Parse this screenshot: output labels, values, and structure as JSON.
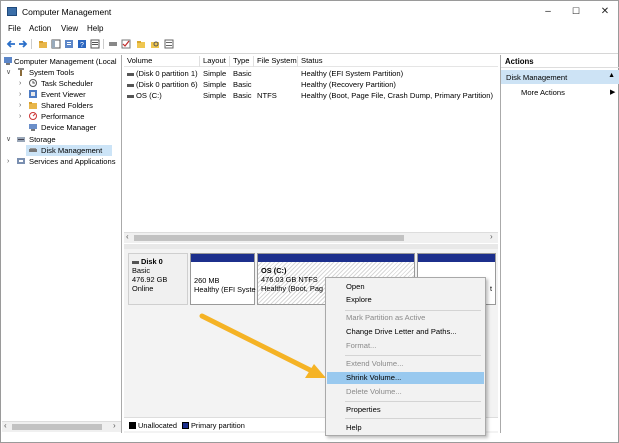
{
  "window": {
    "title": "Computer Management"
  },
  "menu": [
    "File",
    "Action",
    "View",
    "Help"
  ],
  "tree": [
    {
      "label": "Computer Management (Local",
      "indent": 0,
      "exp": ""
    },
    {
      "label": "System Tools",
      "indent": 1,
      "exp": "v"
    },
    {
      "label": "Task Scheduler",
      "indent": 2,
      "exp": ">"
    },
    {
      "label": "Event Viewer",
      "indent": 2,
      "exp": ">"
    },
    {
      "label": "Shared Folders",
      "indent": 2,
      "exp": ">"
    },
    {
      "label": "Performance",
      "indent": 2,
      "exp": ">"
    },
    {
      "label": "Device Manager",
      "indent": 2,
      "exp": ""
    },
    {
      "label": "Storage",
      "indent": 1,
      "exp": "v"
    },
    {
      "label": "Disk Management",
      "indent": 2,
      "exp": ""
    },
    {
      "label": "Services and Applications",
      "indent": 1,
      "exp": ">"
    }
  ],
  "volumes": {
    "columns": [
      "Volume",
      "Layout",
      "Type",
      "File System",
      "Status"
    ],
    "rows": [
      [
        "(Disk 0 partition 1)",
        "Simple",
        "Basic",
        "",
        "Healthy (EFI System Partition)"
      ],
      [
        "(Disk 0 partition 6)",
        "Simple",
        "Basic",
        "",
        "Healthy (Recovery Partition)"
      ],
      [
        "OS (C:)",
        "Simple",
        "Basic",
        "NTFS",
        "Healthy (Boot, Page File, Crash Dump, Primary Partition)"
      ]
    ]
  },
  "disk": {
    "name": "Disk 0",
    "type": "Basic",
    "size": "476.92 GB",
    "state": "Online",
    "p1_size": "260 MB",
    "p1_status": "Healthy (EFI Syste",
    "p2_name": "OS (C:)",
    "p2_size": "476.03 GB NTFS",
    "p2_status": "Healthy (Boot, Pag",
    "p3_tail": "t"
  },
  "legend": {
    "unallocated": "Unallocated",
    "primary": "Primary partition"
  },
  "actions": {
    "header": "Actions",
    "section": "Disk Management",
    "more": "More Actions"
  },
  "context_menu": {
    "open": "Open",
    "explore": "Explore",
    "mark_active": "Mark Partition as Active",
    "change_letter": "Change Drive Letter and Paths...",
    "format": "Format...",
    "extend": "Extend Volume...",
    "shrink": "Shrink Volume...",
    "delete": "Delete Volume...",
    "properties": "Properties",
    "help": "Help"
  },
  "colors": {
    "primary_partition": "#1c2f8c",
    "highlight": "#99c9ef",
    "arrow": "#f5b325"
  }
}
